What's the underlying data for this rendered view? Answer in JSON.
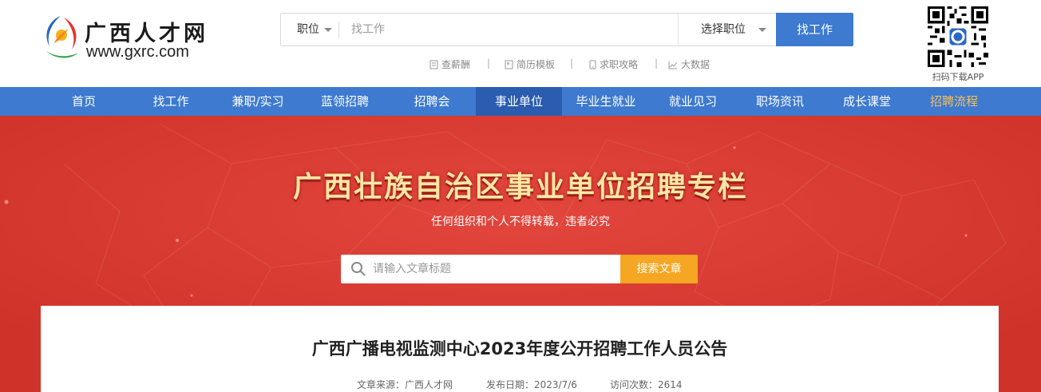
{
  "header": {
    "logo_cn": "广西人才网",
    "logo_url": "www.gxrc.com",
    "search_type": "职位",
    "search_placeholder": "找工作",
    "position_select": "选择职位",
    "search_button": "找工作",
    "quick_links": [
      "查薪酬",
      "简历模板",
      "求职攻略",
      "大数据"
    ],
    "qr_label": "扫码下载APP"
  },
  "nav": {
    "items": [
      "首页",
      "找工作",
      "兼职/实习",
      "蓝领招聘",
      "招聘会",
      "事业单位",
      "毕业生就业",
      "就业见习",
      "职场资讯",
      "成长课堂",
      "招聘流程"
    ],
    "active": "事业单位",
    "highlight": "招聘流程"
  },
  "banner": {
    "title": "广西壮族自治区事业单位招聘专栏",
    "subtitle": "任何组织和个人不得转载，违者必究",
    "search_placeholder": "请输入文章标题",
    "search_button": "搜索文章"
  },
  "article": {
    "title": "广西广播电视监测中心2023年度公开招聘工作人员公告",
    "source_label": "文章来源：",
    "source": "广西人才网",
    "date_label": "发布日期：",
    "date": "2023/7/6",
    "views_label": "访问次数：",
    "views": "2614"
  },
  "colors": {
    "brand_blue": "#3d7ad0",
    "nav_active": "#2a5db0",
    "banner_red": "#d93a32",
    "banner_title": "#fde7a4",
    "search_orange": "#f5a623",
    "nav_highlight": "#f7c05a"
  }
}
